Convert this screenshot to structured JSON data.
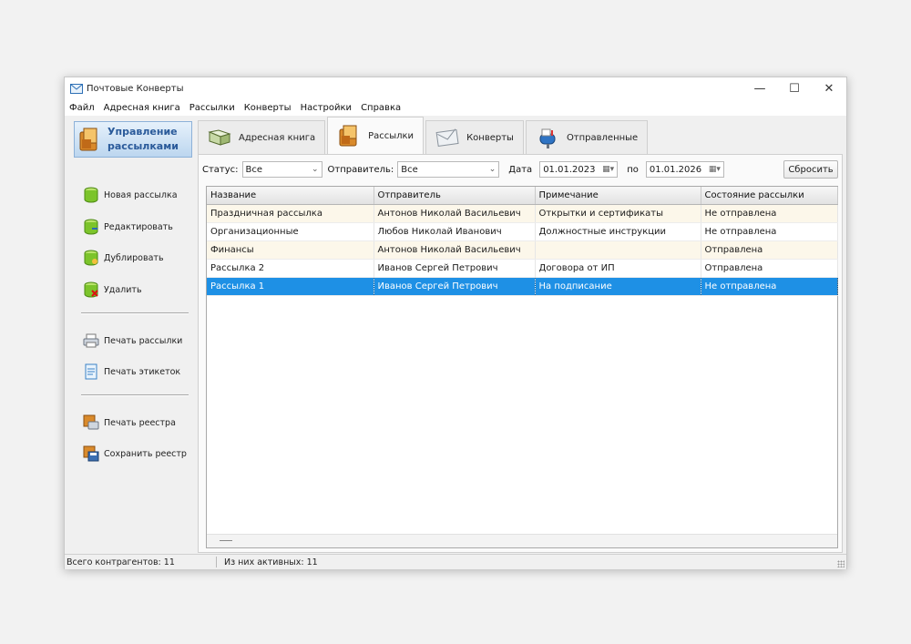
{
  "window": {
    "title": "Почтовые Конверты"
  },
  "menu": [
    "Файл",
    "Адресная книга",
    "Рассылки",
    "Конверты",
    "Настройки",
    "Справка"
  ],
  "sidebar": {
    "header": [
      "Управление",
      "рассылками"
    ],
    "items": [
      {
        "label": "Новая рассылка",
        "icon": "db-add-icon"
      },
      {
        "label": "Редактировать",
        "icon": "db-edit-icon"
      },
      {
        "label": "Дублировать",
        "icon": "db-copy-icon"
      },
      {
        "label": "Удалить",
        "icon": "db-delete-icon"
      },
      {
        "label": "Печать рассылки",
        "icon": "printer-icon"
      },
      {
        "label": "Печать этикеток",
        "icon": "label-icon"
      },
      {
        "label": "Печать реестра",
        "icon": "print-register-icon"
      },
      {
        "label": "Сохранить реестр",
        "icon": "save-register-icon"
      }
    ]
  },
  "tabs": [
    {
      "label": "Адресная книга",
      "icon": "address-book-icon"
    },
    {
      "label": "Рассылки",
      "icon": "mailing-icon"
    },
    {
      "label": "Конверты",
      "icon": "envelope-icon"
    },
    {
      "label": "Отправленные",
      "icon": "mailbox-icon"
    }
  ],
  "active_tab": "Рассылки",
  "filters": {
    "status_label": "Статус:",
    "status_value": "Все",
    "sender_label": "Отправитель:",
    "sender_value": "Все",
    "date_label": "Дата",
    "date_from": "01.01.2023",
    "to_label": "по",
    "date_to": "01.01.2026",
    "reset_label": "Сбросить"
  },
  "table": {
    "columns": [
      "Название",
      "Отправитель",
      "Примечание",
      "Состояние рассылки"
    ],
    "rows": [
      [
        "Праздничная рассылка",
        "Антонов Николай Васильевич",
        "Открытки и сертификаты",
        "Не отправлена"
      ],
      [
        "Организационные",
        "Любов Николай Иванович",
        "Должностные инструкции",
        "Не отправлена"
      ],
      [
        "Финансы",
        "Антонов Николай Васильевич",
        "",
        "Отправлена"
      ],
      [
        "Рассылка 2",
        "Иванов Сергей Петрович",
        "Договора от ИП",
        "Отправлена"
      ],
      [
        "Рассылка 1",
        "Иванов Сергей Петрович",
        "На подписание",
        "Не отправлена"
      ]
    ],
    "selected_row": 4
  },
  "status": {
    "total": "Всего контрагентов: 11",
    "active": "Из них активных: 11"
  },
  "colors": {
    "selection": "#1e90e5",
    "row_alt": "#fcf7ea",
    "header_accent": "#2a5a9a"
  }
}
